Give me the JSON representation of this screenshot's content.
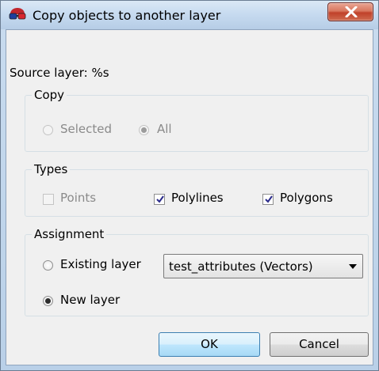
{
  "window": {
    "title": "Copy objects to another layer"
  },
  "source_label": "Source layer: %s",
  "copy_group": {
    "legend": "Copy",
    "options": [
      {
        "label": "Selected",
        "selected": false,
        "enabled": false
      },
      {
        "label": "All",
        "selected": true,
        "enabled": false
      }
    ]
  },
  "types_group": {
    "legend": "Types",
    "options": [
      {
        "label": "Points",
        "checked": false,
        "enabled": false
      },
      {
        "label": "Polylines",
        "checked": true,
        "enabled": true
      },
      {
        "label": "Polygons",
        "checked": true,
        "enabled": true
      }
    ]
  },
  "assignment_group": {
    "legend": "Assignment",
    "existing_label": "Existing layer",
    "existing_selected": false,
    "layer_select_value": "test_attributes (Vectors)",
    "new_label": "New layer",
    "new_selected": true
  },
  "buttons": {
    "ok": "OK",
    "cancel": "Cancel"
  },
  "icons": {
    "app": "3d-glasses-icon",
    "close": "close-icon",
    "dropdown": "chevron-down-icon"
  },
  "colors": {
    "close_button": "#c7442c",
    "focus_border": "#3c7fb1"
  }
}
